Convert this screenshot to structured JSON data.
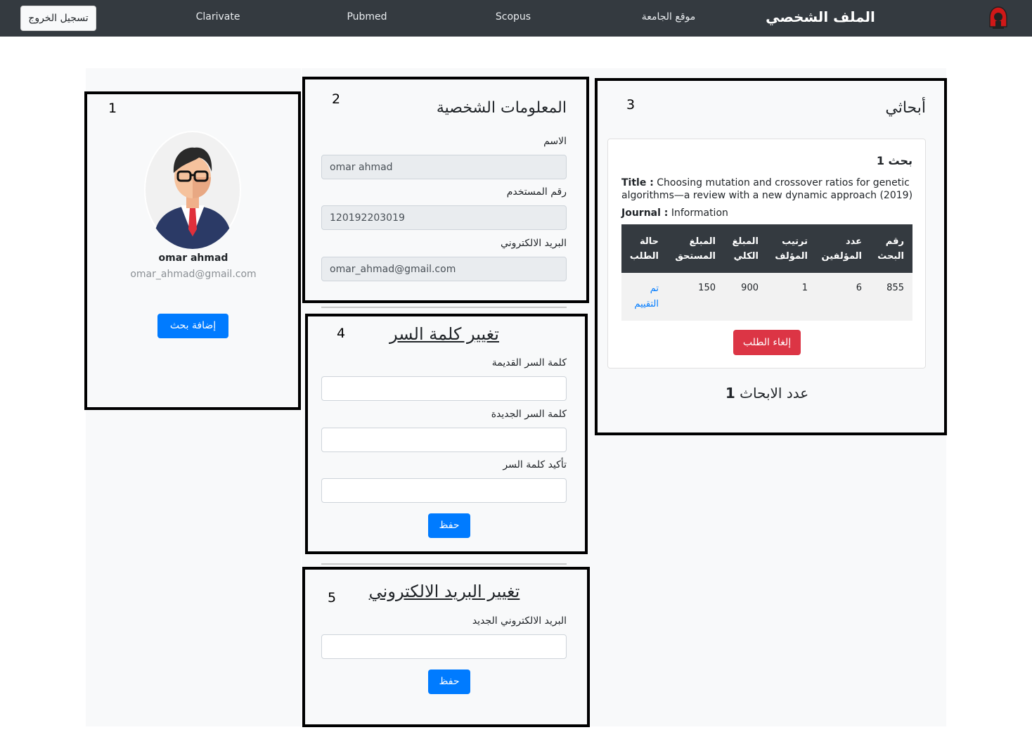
{
  "navbar": {
    "logout_label": "تسجيل الخروج",
    "links": [
      "Clarivate",
      "Pubmed",
      "Scopus",
      "موقع الجامعة"
    ],
    "brand": "الملف الشخصي"
  },
  "box_numbers": [
    "1",
    "2",
    "3",
    "4",
    "5"
  ],
  "profile": {
    "name": "omar ahmad",
    "email": "omar_ahmad@gmail.com",
    "add_research_label": "إضافة بحث"
  },
  "personal_info": {
    "title": "المعلومات الشخصية",
    "name_label": "الاسم",
    "name_value": "omar ahmad",
    "username_label": "رقم المستخدم",
    "username_value": "120192203019",
    "email_label": "البريد الالكتروني",
    "email_value": "omar_ahmad@gmail.com"
  },
  "change_password": {
    "title": "تغيير كلمة السر",
    "old_label": "كلمة السر القديمة",
    "new_label": "كلمة السر الجديدة",
    "confirm_label": "تأكيد كلمة السر",
    "save_label": "حفظ"
  },
  "change_email": {
    "title": "تغيير البريد الالكتروني",
    "new_email_label": "البريد الالكتروني الجديد",
    "save_label": "حفظ"
  },
  "my_research": {
    "title": "أبحاثي",
    "paper": {
      "heading": "بحث 1",
      "title_key": "Title :",
      "title_value": "Choosing mutation and crossover ratios for genetic algorithms—a review with a new dynamic approach (2019)",
      "journal_key": "Journal :",
      "journal_value": "Information"
    },
    "table": {
      "headers": [
        [
          "رقم",
          "البحث"
        ],
        [
          "عدد",
          "المؤلفين"
        ],
        [
          "ترتيب",
          "المؤلف"
        ],
        [
          "المبلغ",
          "الكلي"
        ],
        [
          "المبلغ",
          "المستحق"
        ],
        [
          "حالة",
          "الطلب"
        ]
      ],
      "row": [
        "855",
        "6",
        "1",
        "900",
        "150"
      ],
      "status": [
        "تم",
        "التقييم"
      ]
    },
    "cancel_label": "إلغاء الطلب",
    "count_label": "عدد الابحاث",
    "count_value": "1"
  },
  "colors": {
    "navbar": "#343a40",
    "primary": "#007bff",
    "danger": "#dc3545",
    "panel": "#f8f9fa"
  }
}
